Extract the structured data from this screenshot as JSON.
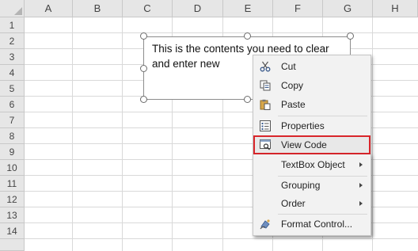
{
  "columns": [
    "A",
    "B",
    "C",
    "D",
    "E",
    "F",
    "G",
    "H"
  ],
  "rows": [
    "1",
    "2",
    "3",
    "4",
    "5",
    "6",
    "7",
    "8",
    "9",
    "10",
    "11",
    "12",
    "13",
    "14"
  ],
  "textbox": {
    "text_line1": "This is the contents you need to clear",
    "text_line2": "and enter new"
  },
  "context_menu": {
    "items": [
      {
        "label": "Cut",
        "icon": "scissors-icon"
      },
      {
        "label": "Copy",
        "icon": "copy-icon"
      },
      {
        "label": "Paste",
        "icon": "paste-icon"
      },
      {
        "label": "Properties",
        "icon": "properties-icon"
      },
      {
        "label": "View Code",
        "icon": "view-code-icon"
      },
      {
        "label": "TextBox Object",
        "icon": "",
        "submenu": true
      },
      {
        "label": "Grouping",
        "icon": "",
        "submenu": true
      },
      {
        "label": "Order",
        "icon": "",
        "submenu": true
      },
      {
        "label": "Format Control...",
        "icon": "format-control-icon"
      }
    ],
    "highlighted_item": "View Code",
    "highlight_color": "#d9262b"
  }
}
